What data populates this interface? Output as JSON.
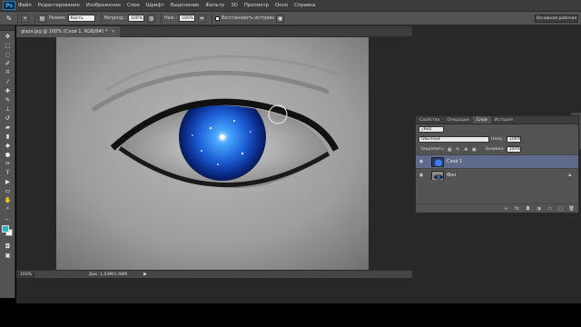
{
  "app": {
    "logo": "Ps"
  },
  "menu": [
    "Файл",
    "Редактирование",
    "Изображение",
    "Слои",
    "Шрифт",
    "Выделение",
    "Фильтр",
    "3D",
    "Просмотр",
    "Окно",
    "Справка"
  ],
  "options": {
    "mode_label": "Режим:",
    "mode_value": "Кисть",
    "opacity_label": "Непрозр.:",
    "opacity_value": "100%",
    "pressure_label": "Наж.:",
    "pressure_value": "100%",
    "history_label": "Восстановить историю",
    "workspace": "Основная рабочая"
  },
  "document": {
    "tab_title": "glaza.jpg @ 100% (Слой 1, RGB/8#) *",
    "zoom": "100%",
    "doc_size": "Док: 1,03М/1,98М"
  },
  "layers_panel": {
    "tabs": [
      "Свойства",
      "Операции",
      "Слои",
      "История"
    ],
    "active_tab": "Слои",
    "filter_value": "Вид",
    "blend_mode": "Обычные",
    "opacity_label": "Непр.:",
    "opacity_value": "100%",
    "lock_label": "Закрепить:",
    "fill_label": "Заливка:",
    "fill_value": "100%",
    "layers": [
      {
        "name": "Слой 1",
        "selected": true
      },
      {
        "name": "Фон",
        "selected": false,
        "locked": true
      }
    ]
  },
  "colors": {
    "foreground": "#27b7bd",
    "background": "#ffffff",
    "selected_layer": "#5d6a8a"
  }
}
